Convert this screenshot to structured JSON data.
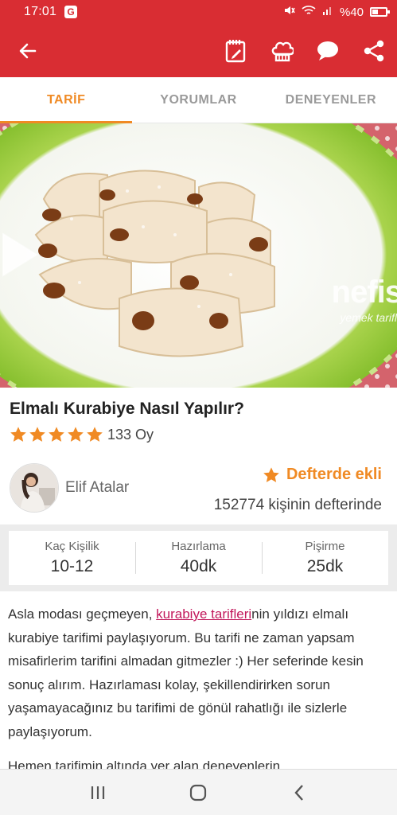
{
  "status_bar": {
    "time": "17:01",
    "app_badge": "G",
    "battery": "%40"
  },
  "app_bar": {
    "back_icon": "arrow-left-icon",
    "action_icons": [
      "notepad-icon",
      "chef-hat-icon",
      "comment-icon",
      "share-icon"
    ]
  },
  "tabs": [
    {
      "label": "TARİF",
      "active": true
    },
    {
      "label": "YORUMLAR",
      "active": false
    },
    {
      "label": "DENEYENLER",
      "active": false
    }
  ],
  "hero": {
    "watermark": "nefis",
    "watermark_sub": "yemek tarifl"
  },
  "recipe": {
    "title": "Elmalı Kurabiye Nasıl Yapılır?",
    "rating_stars": 5,
    "votes": "133 Oy"
  },
  "author": {
    "name": "Elif Atalar"
  },
  "notebook": {
    "status": "Defterde ekli",
    "count_text": "152774 kişinin defterinde"
  },
  "info": [
    {
      "label": "Kaç Kişilik",
      "value": "10-12"
    },
    {
      "label": "Hazırlama",
      "value": "40dk"
    },
    {
      "label": "Pişirme",
      "value": "25dk"
    }
  ],
  "description": {
    "intro": "Asla modası geçmeyen, ",
    "link": "kurabiye tarifleri",
    "rest": "nin yıldızı elmalı kurabiye tarifimi paylaşıyorum. Bu tarifi ne zaman yapsam misafirlerim tarifini almadan gitmezler :) Her seferinde kesin sonuç alırım. Hazırlaması kolay, şekillendirirken sorun yaşamayacağınız bu tarifimi de gönül rahatlığı ile sizlerle paylaşıyorum.",
    "next": "Hemen tarifimin altında yer alan deneyenlerin"
  },
  "colors": {
    "primary": "#d92d33",
    "accent": "#f08a24",
    "link": "#c2185b"
  }
}
